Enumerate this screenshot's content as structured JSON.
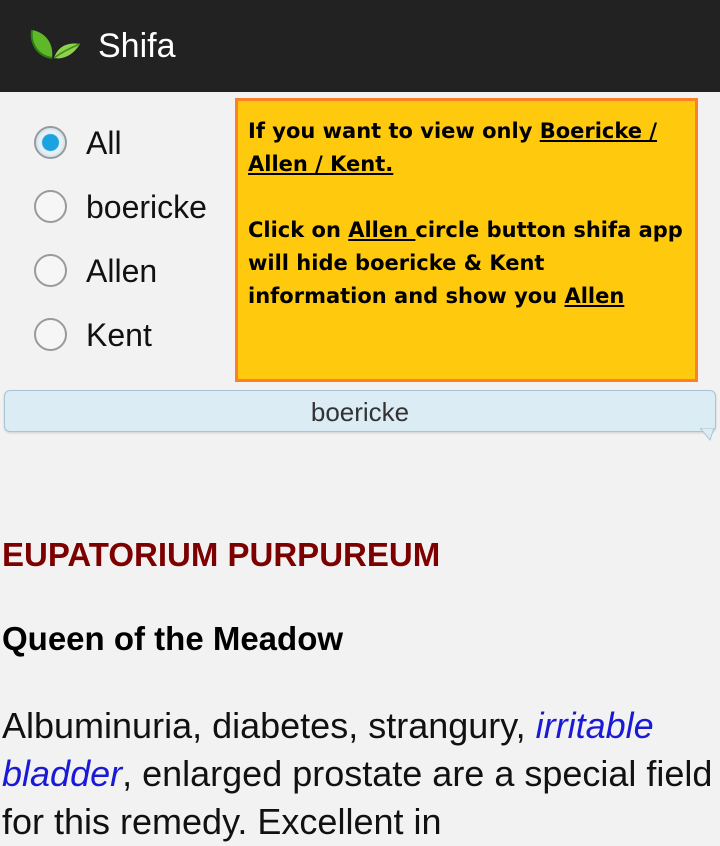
{
  "app": {
    "title": "Shifa",
    "logo_icon": "leaf-icon"
  },
  "filter": {
    "options": [
      {
        "label": "All",
        "checked": true
      },
      {
        "label": "boericke",
        "checked": false
      },
      {
        "label": "Allen",
        "checked": false
      },
      {
        "label": "Kent",
        "checked": false
      }
    ]
  },
  "callout": {
    "line1_pre": "If you want to view only ",
    "line1_link": "Boericke / Allen / Kent.",
    "line2_pre": "Click on ",
    "line2_link": "Allen ",
    "line2_mid": "circle button shifa app will hide boericke & Kent information and show you ",
    "line2_end": "Allen",
    "background": "#ffc90e",
    "border": "#ff7f27"
  },
  "source_bar": {
    "label": "boericke"
  },
  "remedy": {
    "name": "EUPATORIUM PURPUREUM",
    "common_name": "Queen of the Meadow",
    "text_before": "Albuminuria, diabetes, strangury, ",
    "text_italic": "irritable bladder",
    "text_after": ", enlarged prostate are a special field for this remedy. Excellent in",
    "name_color": "#7d0000",
    "italic_color": "#1a1ad6"
  }
}
